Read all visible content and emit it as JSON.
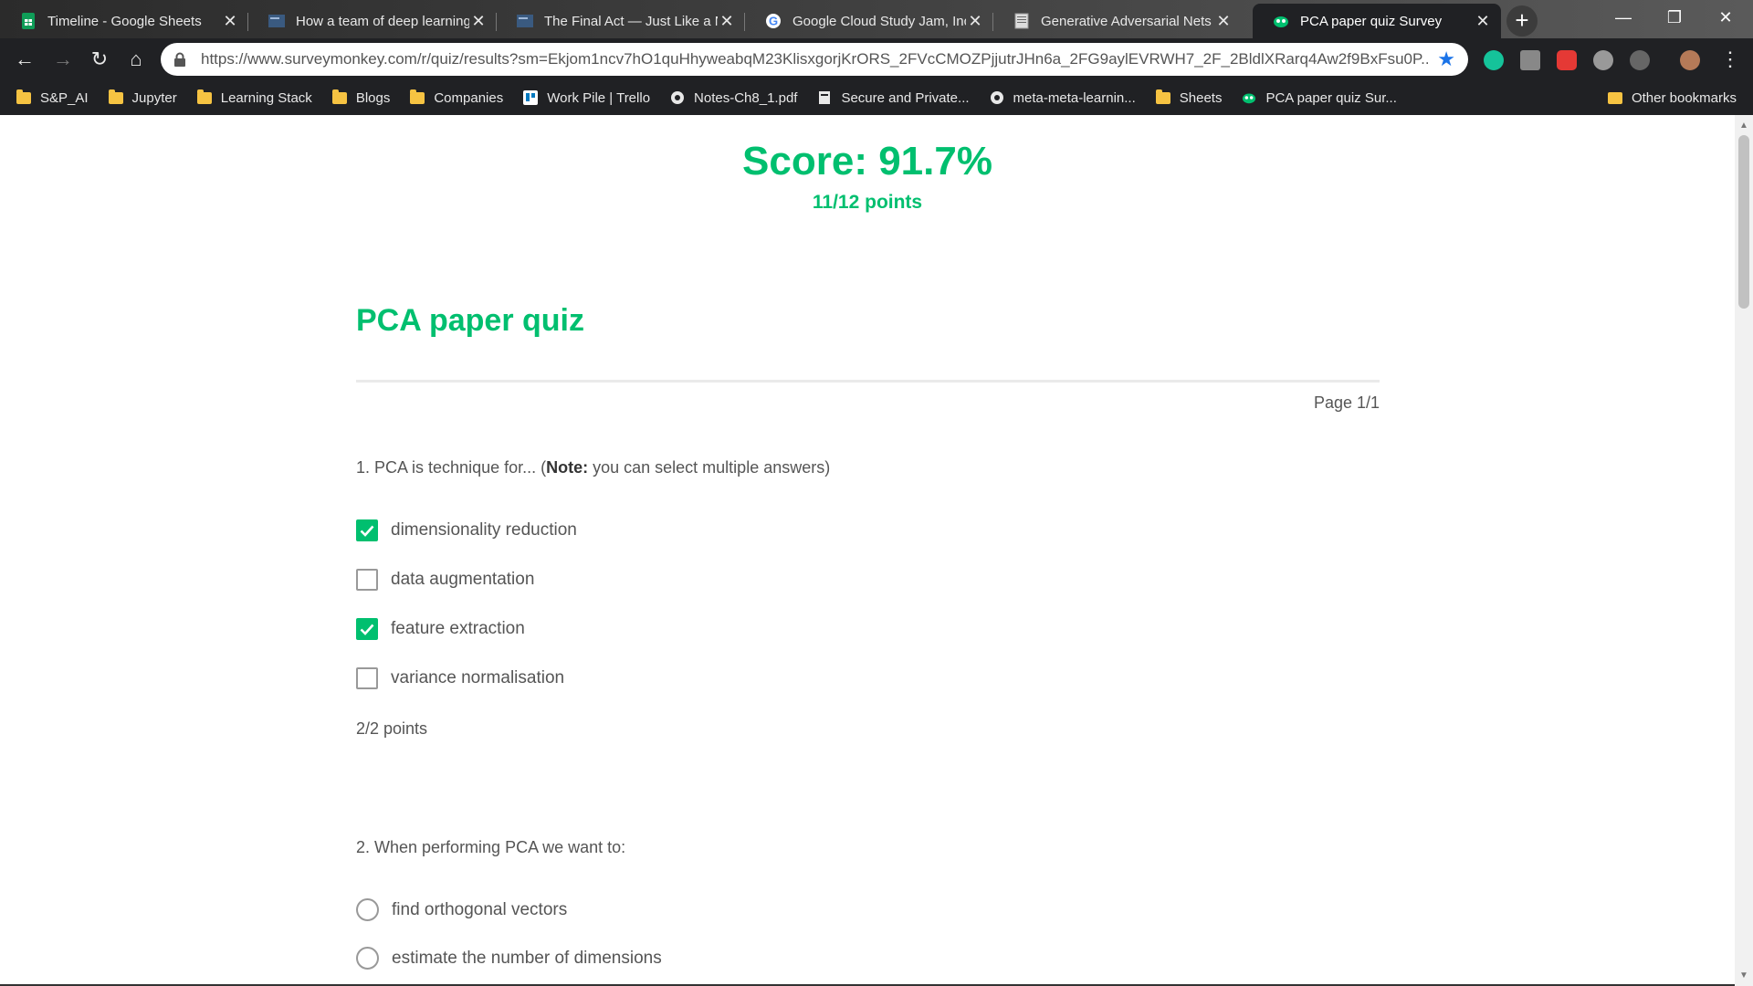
{
  "browser": {
    "tabs": [
      {
        "title": "Timeline - Google Sheets",
        "icon": "google-sheets-icon",
        "active": false
      },
      {
        "title": "How a team of deep learning",
        "icon": "article-thumbnail-icon",
        "active": false
      },
      {
        "title": "The Final Act — Just Like a N",
        "icon": "article-thumbnail-icon",
        "active": false
      },
      {
        "title": "Google Cloud Study Jam, Inc",
        "icon": "google-icon",
        "active": false
      },
      {
        "title": "Generative Adversarial Nets",
        "icon": "pdf-page-icon",
        "active": false
      },
      {
        "title": "PCA paper quiz Survey",
        "icon": "surveymonkey-icon",
        "active": true
      }
    ],
    "url": "https://www.surveymonkey.com/r/quiz/results?sm=Ekjom1ncv7hO1quHhyweabqM23KlisxgorjKrORS_2FVcCMOZPjjutrJHn6a_2FG9aylEVRWH7_2F_2BldlXRarq4Aw2f9BxFsu0P...",
    "bookmarks": [
      {
        "label": "S&P_AI",
        "icon": "folder-icon"
      },
      {
        "label": "Jupyter",
        "icon": "folder-icon"
      },
      {
        "label": "Learning Stack",
        "icon": "folder-icon"
      },
      {
        "label": "Blogs",
        "icon": "folder-icon"
      },
      {
        "label": "Companies",
        "icon": "folder-icon"
      },
      {
        "label": "Work Pile | Trello",
        "icon": "trello-icon"
      },
      {
        "label": "Notes-Ch8_1.pdf",
        "icon": "globe-icon"
      },
      {
        "label": "Secure and Private...",
        "icon": "bookmark-page-icon"
      },
      {
        "label": "meta-meta-learnin...",
        "icon": "globe-icon"
      },
      {
        "label": "Sheets",
        "icon": "folder-icon"
      },
      {
        "label": "PCA paper quiz Sur...",
        "icon": "surveymonkey-icon"
      }
    ],
    "other_bookmarks": "Other bookmarks"
  },
  "results": {
    "score": "Score: 91.7%",
    "points": "11/12 points",
    "quiz_title": "PCA paper quiz",
    "page": "Page 1/1"
  },
  "questions": [
    {
      "text_prefix": "1. PCA is technique for... (",
      "text_bold": "Note:",
      "text_suffix": " you can select multiple answers)",
      "type": "checkbox",
      "options": [
        {
          "label": "dimensionality reduction",
          "checked": true
        },
        {
          "label": "data augmentation",
          "checked": false
        },
        {
          "label": "feature extraction",
          "checked": true
        },
        {
          "label": "variance normalisation",
          "checked": false
        }
      ],
      "points": "2/2 points"
    },
    {
      "text": "2. When performing PCA we want to:",
      "type": "radio",
      "options": [
        {
          "label": "find orthogonal vectors",
          "checked": false
        },
        {
          "label": "estimate the number of dimensions",
          "checked": false
        }
      ]
    }
  ],
  "colors": {
    "accent": "#00bf6f",
    "text": "#555555",
    "browser_dark": "#202124"
  }
}
